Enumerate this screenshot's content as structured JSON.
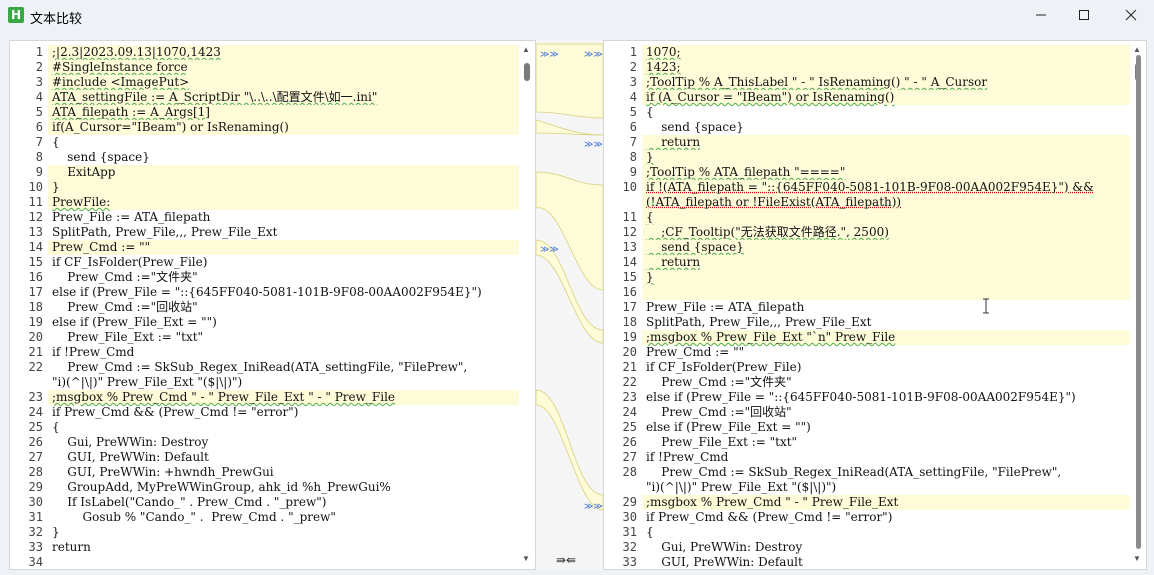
{
  "window": {
    "title": "文本比较",
    "app_icon": "H"
  },
  "middle": {
    "merge_label": "⇛⇚",
    "marker": "≫≫"
  },
  "left": {
    "lines": [
      {
        "n": "1",
        "t": ";|2.3|2023.09.13|1070,1423",
        "hl": true,
        "sq": true
      },
      {
        "n": "2",
        "t": "#SingleInstance force",
        "hl": true,
        "sq": true
      },
      {
        "n": "3",
        "t": "#include <ImagePut>",
        "hl": true,
        "sq": true
      },
      {
        "n": "4",
        "t": "ATA_settingFile := A_ScriptDir \"\\..\\..\\配置文件\\如一.ini\"",
        "hl": true,
        "sq": true
      },
      {
        "n": "5",
        "t": "ATA_filepath := A_Args[1]",
        "hl": true,
        "sq": true
      },
      {
        "n": "6",
        "t": "if(A_Cursor=\"IBeam\") or IsRenaming()",
        "hl": true
      },
      {
        "n": "7",
        "t": "{"
      },
      {
        "n": "8",
        "t": "    send {space}"
      },
      {
        "n": "9",
        "t": "    ExitApp",
        "hl": true
      },
      {
        "n": "10",
        "t": "}",
        "hl": true
      },
      {
        "n": "11",
        "t": "PrewFile:",
        "hl": true,
        "sq": true
      },
      {
        "n": "12",
        "t": "Prew_File := ATA_filepath"
      },
      {
        "n": "13",
        "t": "SplitPath, Prew_File,,, Prew_File_Ext"
      },
      {
        "n": "14",
        "t": "Prew_Cmd := \"\"",
        "hl": true
      },
      {
        "n": "15",
        "t": "if CF_IsFolder(Prew_File)"
      },
      {
        "n": "16",
        "t": "    Prew_Cmd :=\"文件夹\""
      },
      {
        "n": "17",
        "t": "else if (Prew_File = \"::{645FF040-5081-101B-9F08-00AA002F954E}\")"
      },
      {
        "n": "18",
        "t": "    Prew_Cmd :=\"回收站\""
      },
      {
        "n": "19",
        "t": "else if (Prew_File_Ext = \"\")"
      },
      {
        "n": "20",
        "t": "    Prew_File_Ext := \"txt\""
      },
      {
        "n": "21",
        "t": "if !Prew_Cmd"
      },
      {
        "n": "22",
        "t": "    Prew_Cmd := SkSub_Regex_IniRead(ATA_settingFile, \"FilePrew\","
      },
      {
        "n": "",
        "t": "\"i)(^|\\|)\" Prew_File_Ext \"($|\\|)\")"
      },
      {
        "n": "23",
        "t": ";msgbox % Prew_Cmd \" - \" Prew_File_Ext \" - \" Prew_File",
        "hl": true,
        "sq": true
      },
      {
        "n": "24",
        "t": "if Prew_Cmd && (Prew_Cmd != \"error\")"
      },
      {
        "n": "25",
        "t": "{"
      },
      {
        "n": "26",
        "t": "    Gui, PreWWin: Destroy"
      },
      {
        "n": "27",
        "t": "    GUI, PreWWin: Default"
      },
      {
        "n": "28",
        "t": "    GUI, PreWWin: +hwndh_PrewGui"
      },
      {
        "n": "29",
        "t": "    GroupAdd, MyPreWWinGroup, ahk_id %h_PrewGui%"
      },
      {
        "n": "30",
        "t": "    If IsLabel(\"Cando_\" . Prew_Cmd . \"_prew\")"
      },
      {
        "n": "31",
        "t": "        Gosub % \"Cando_\" .  Prew_Cmd . \"_prew\""
      },
      {
        "n": "32",
        "t": "}"
      },
      {
        "n": "33",
        "t": "return"
      },
      {
        "n": "34",
        "t": ""
      }
    ]
  },
  "right": {
    "lines": [
      {
        "n": "1",
        "t": "1070;",
        "hl": true,
        "sq": true
      },
      {
        "n": "2",
        "t": "1423;",
        "hl": true,
        "sq": true
      },
      {
        "n": "3",
        "t": ";ToolTip % A_ThisLabel \" - \" IsRenaming() \" - \" A_Cursor",
        "hl": true,
        "sq": true
      },
      {
        "n": "4",
        "t": "if (A_Cursor = \"IBeam\") or IsRenaming()",
        "hl": true,
        "sq": true
      },
      {
        "n": "5",
        "t": "{"
      },
      {
        "n": "6",
        "t": "    send {space}"
      },
      {
        "n": "7",
        "t": "    return",
        "hl": true,
        "sq": true
      },
      {
        "n": "8",
        "t": "}",
        "hl": true,
        "sq": true
      },
      {
        "n": "9",
        "t": ";ToolTip % ATA_filepath \"====\"",
        "hl": true,
        "sq": true
      },
      {
        "n": "10",
        "t": "if !(ATA_filepath = \"::{645FF040-5081-101B-9F08-00AA002F954E}\") &&",
        "hl": true,
        "sqr": true
      },
      {
        "n": "",
        "t": "(!ATA_filepath or !FileExist(ATA_filepath))",
        "hl": true,
        "sqr": true
      },
      {
        "n": "11",
        "t": "{",
        "hl": true,
        "sq": true
      },
      {
        "n": "12",
        "t": "    ;CF_Tooltip(\"无法获取文件路径.\", 2500)",
        "hl": true,
        "sq": true
      },
      {
        "n": "13",
        "t": "    send {space}",
        "hl": true,
        "sq": true
      },
      {
        "n": "14",
        "t": "    return",
        "hl": true,
        "sq": true
      },
      {
        "n": "15",
        "t": "}",
        "hl": true,
        "sq": true
      },
      {
        "n": "16",
        "t": "",
        "hl": true
      },
      {
        "n": "17",
        "t": "Prew_File := ATA_filepath"
      },
      {
        "n": "18",
        "t": "SplitPath, Prew_File,,, Prew_File_Ext"
      },
      {
        "n": "19",
        "t": ";msgbox % Prew_File_Ext \"`n\" Prew_File",
        "hl": true,
        "sq": true
      },
      {
        "n": "20",
        "t": "Prew_Cmd := \"\""
      },
      {
        "n": "21",
        "t": "if CF_IsFolder(Prew_File)"
      },
      {
        "n": "22",
        "t": "    Prew_Cmd :=\"文件夹\""
      },
      {
        "n": "23",
        "t": "else if (Prew_File = \"::{645FF040-5081-101B-9F08-00AA002F954E}\")"
      },
      {
        "n": "24",
        "t": "    Prew_Cmd :=\"回收站\""
      },
      {
        "n": "25",
        "t": "else if (Prew_File_Ext = \"\")"
      },
      {
        "n": "26",
        "t": "    Prew_File_Ext := \"txt\""
      },
      {
        "n": "27",
        "t": "if !Prew_Cmd"
      },
      {
        "n": "28",
        "t": "    Prew_Cmd := SkSub_Regex_IniRead(ATA_settingFile, \"FilePrew\","
      },
      {
        "n": "",
        "t": "\"i)(^|\\|)\" Prew_File_Ext \"($|\\|)\")"
      },
      {
        "n": "29",
        "t": ";msgbox % Prew_Cmd \" - \" Prew_File_Ext",
        "hl": true
      },
      {
        "n": "30",
        "t": "if Prew_Cmd && (Prew_Cmd != \"error\")"
      },
      {
        "n": "31",
        "t": "{"
      },
      {
        "n": "32",
        "t": "    Gui, PreWWin: Destroy"
      },
      {
        "n": "33",
        "t": "    GUI, PreWWin: Default"
      }
    ]
  }
}
